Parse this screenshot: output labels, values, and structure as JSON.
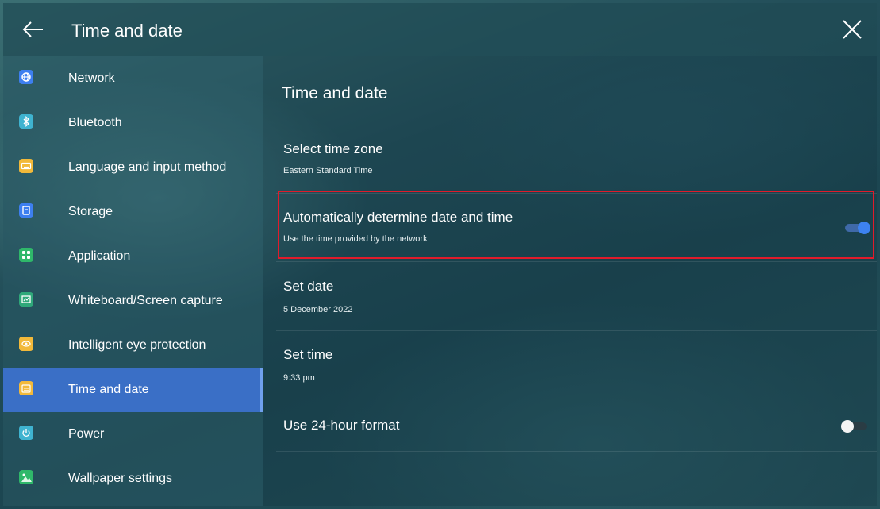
{
  "header": {
    "title": "Time and date",
    "back_icon": "arrow-left-icon",
    "close_icon": "close-icon"
  },
  "sidebar": {
    "items": [
      {
        "label": "Network",
        "icon": "globe-icon",
        "color": "#3d7ff0"
      },
      {
        "label": "Bluetooth",
        "icon": "bluetooth-icon",
        "color": "#3fb3d0"
      },
      {
        "label": "Language and input method",
        "icon": "keyboard-icon",
        "color": "#f2b93a"
      },
      {
        "label": "Storage",
        "icon": "storage-icon",
        "color": "#3d7ff0"
      },
      {
        "label": "Application",
        "icon": "apps-icon",
        "color": "#2fb86a"
      },
      {
        "label": "Whiteboard/Screen capture",
        "icon": "whiteboard-icon",
        "color": "#2fa87a"
      },
      {
        "label": "Intelligent eye protection",
        "icon": "eye-icon",
        "color": "#f2b93a"
      },
      {
        "label": "Time and date",
        "icon": "calendar-icon",
        "color": "#f2b93a",
        "active": true
      },
      {
        "label": "Power",
        "icon": "power-icon",
        "color": "#3fb3d0"
      },
      {
        "label": "Wallpaper settings",
        "icon": "image-icon",
        "color": "#2fb86a"
      }
    ]
  },
  "main": {
    "title": "Time and date",
    "settings": [
      {
        "title": "Select time zone",
        "subtitle": "Eastern Standard Time"
      },
      {
        "title": "Automatically determine date and time",
        "subtitle": "Use the time provided by the network",
        "toggle": true,
        "highlighted": true
      },
      {
        "title": "Set date",
        "subtitle": "5 December 2022"
      },
      {
        "title": "Set time",
        "subtitle": "9:33 pm"
      },
      {
        "title": "Use 24-hour format",
        "toggle": false
      }
    ]
  },
  "colors": {
    "accent": "#3a6fc6",
    "toggle_on": "#3d82f0",
    "highlight_border": "#e01b2b"
  }
}
